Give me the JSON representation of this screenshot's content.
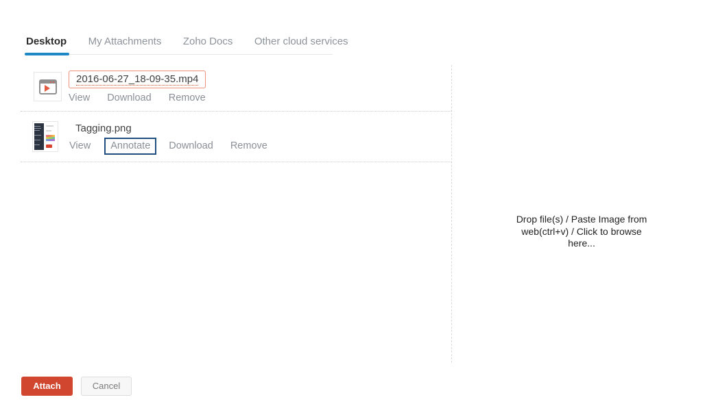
{
  "tabs": [
    {
      "label": "Desktop",
      "active": true
    },
    {
      "label": "My Attachments",
      "active": false
    },
    {
      "label": "Zoho Docs",
      "active": false
    },
    {
      "label": "Other cloud services",
      "active": false
    }
  ],
  "files": [
    {
      "name": "2016-06-27_18-09-35.mp4",
      "icon": "video-player-icon",
      "actions": [
        "View",
        "Download",
        "Remove"
      ]
    },
    {
      "name": "Tagging.png",
      "icon": "screenshot-thumbnail",
      "actions": [
        "View",
        "Annotate",
        "Download",
        "Remove"
      ]
    }
  ],
  "dropzone": {
    "text": "Drop file(s) / Paste Image from web(ctrl+v) / Click to browse here..."
  },
  "footer": {
    "attach_label": "Attach",
    "cancel_label": "Cancel"
  },
  "colors": {
    "tab_active_underline": "#1e87c6",
    "attach_button": "#d0462e",
    "annotate_outline": "#1d4e7f",
    "filename_outline": "#ef8e7b",
    "dotted_underline": "#dd4a33"
  }
}
